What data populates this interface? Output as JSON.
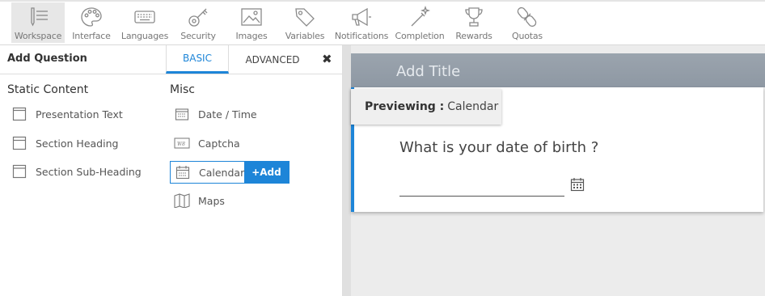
{
  "toolbar": {
    "items": [
      {
        "label": "Workspace",
        "icon": "pencil-lines-icon"
      },
      {
        "label": "Interface",
        "icon": "palette-icon"
      },
      {
        "label": "Languages",
        "icon": "keyboard-icon"
      },
      {
        "label": "Security",
        "icon": "key-icon"
      },
      {
        "label": "Images",
        "icon": "image-icon"
      },
      {
        "label": "Variables",
        "icon": "tag-icon"
      },
      {
        "label": "Notifications",
        "icon": "megaphone-icon"
      },
      {
        "label": "Completion",
        "icon": "magic-wand-icon"
      },
      {
        "label": "Rewards",
        "icon": "trophy-icon"
      },
      {
        "label": "Quotas",
        "icon": "chain-link-icon"
      }
    ],
    "active": "Workspace"
  },
  "panel": {
    "title": "Add Question",
    "tabs": {
      "basic": "BASIC",
      "advanced": "ADVANCED"
    },
    "close": "✖",
    "static_content": {
      "title": "Static Content",
      "items": [
        "Presentation Text",
        "Section Heading",
        "Section Sub-Heading"
      ]
    },
    "misc": {
      "title": "Misc",
      "items": [
        "Date / Time",
        "Captcha",
        "Calendar",
        "Maps"
      ]
    },
    "add_button": "+Add"
  },
  "canvas": {
    "title_placeholder": "Add Title",
    "preview_label": "Previewing :",
    "preview_value": "Calendar",
    "question": "What is your date of birth ?"
  },
  "colors": {
    "accent": "#1d85d8",
    "title_bar": "#959fa9"
  }
}
